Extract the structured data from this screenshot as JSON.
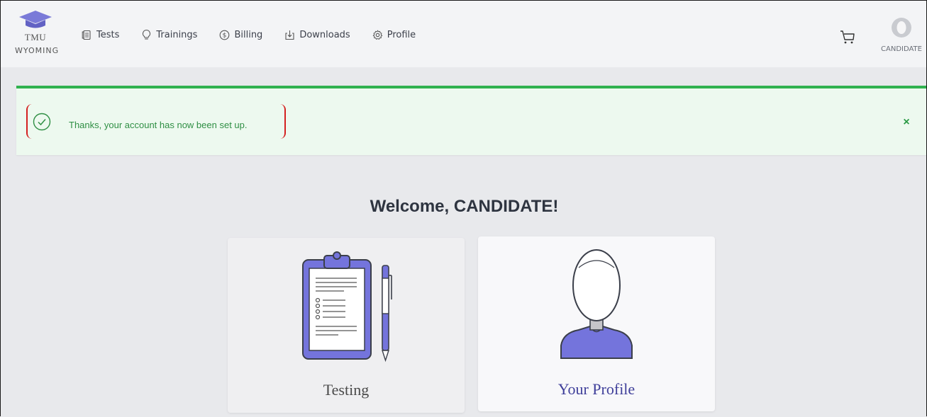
{
  "logo": {
    "line1": "TMU",
    "line2": "WYOMING"
  },
  "nav": {
    "items": [
      {
        "label": "Tests",
        "icon": "tests-icon"
      },
      {
        "label": "Trainings",
        "icon": "lightbulb-icon"
      },
      {
        "label": "Billing",
        "icon": "dollar-icon"
      },
      {
        "label": "Downloads",
        "icon": "download-icon"
      },
      {
        "label": "Profile",
        "icon": "gear-icon"
      }
    ]
  },
  "user": {
    "name": "CANDIDATE"
  },
  "alert": {
    "message": "Thanks, your account has now been set up.",
    "close": "×"
  },
  "welcome": {
    "title": "Welcome, CANDIDATE!"
  },
  "cards": {
    "testing": {
      "label": "Testing"
    },
    "profile": {
      "label": "Your Profile"
    }
  },
  "colors": {
    "accent": "#7474dc",
    "success": "#31b24f",
    "success_bg": "#edf9ef",
    "highlight": "#d42020"
  }
}
